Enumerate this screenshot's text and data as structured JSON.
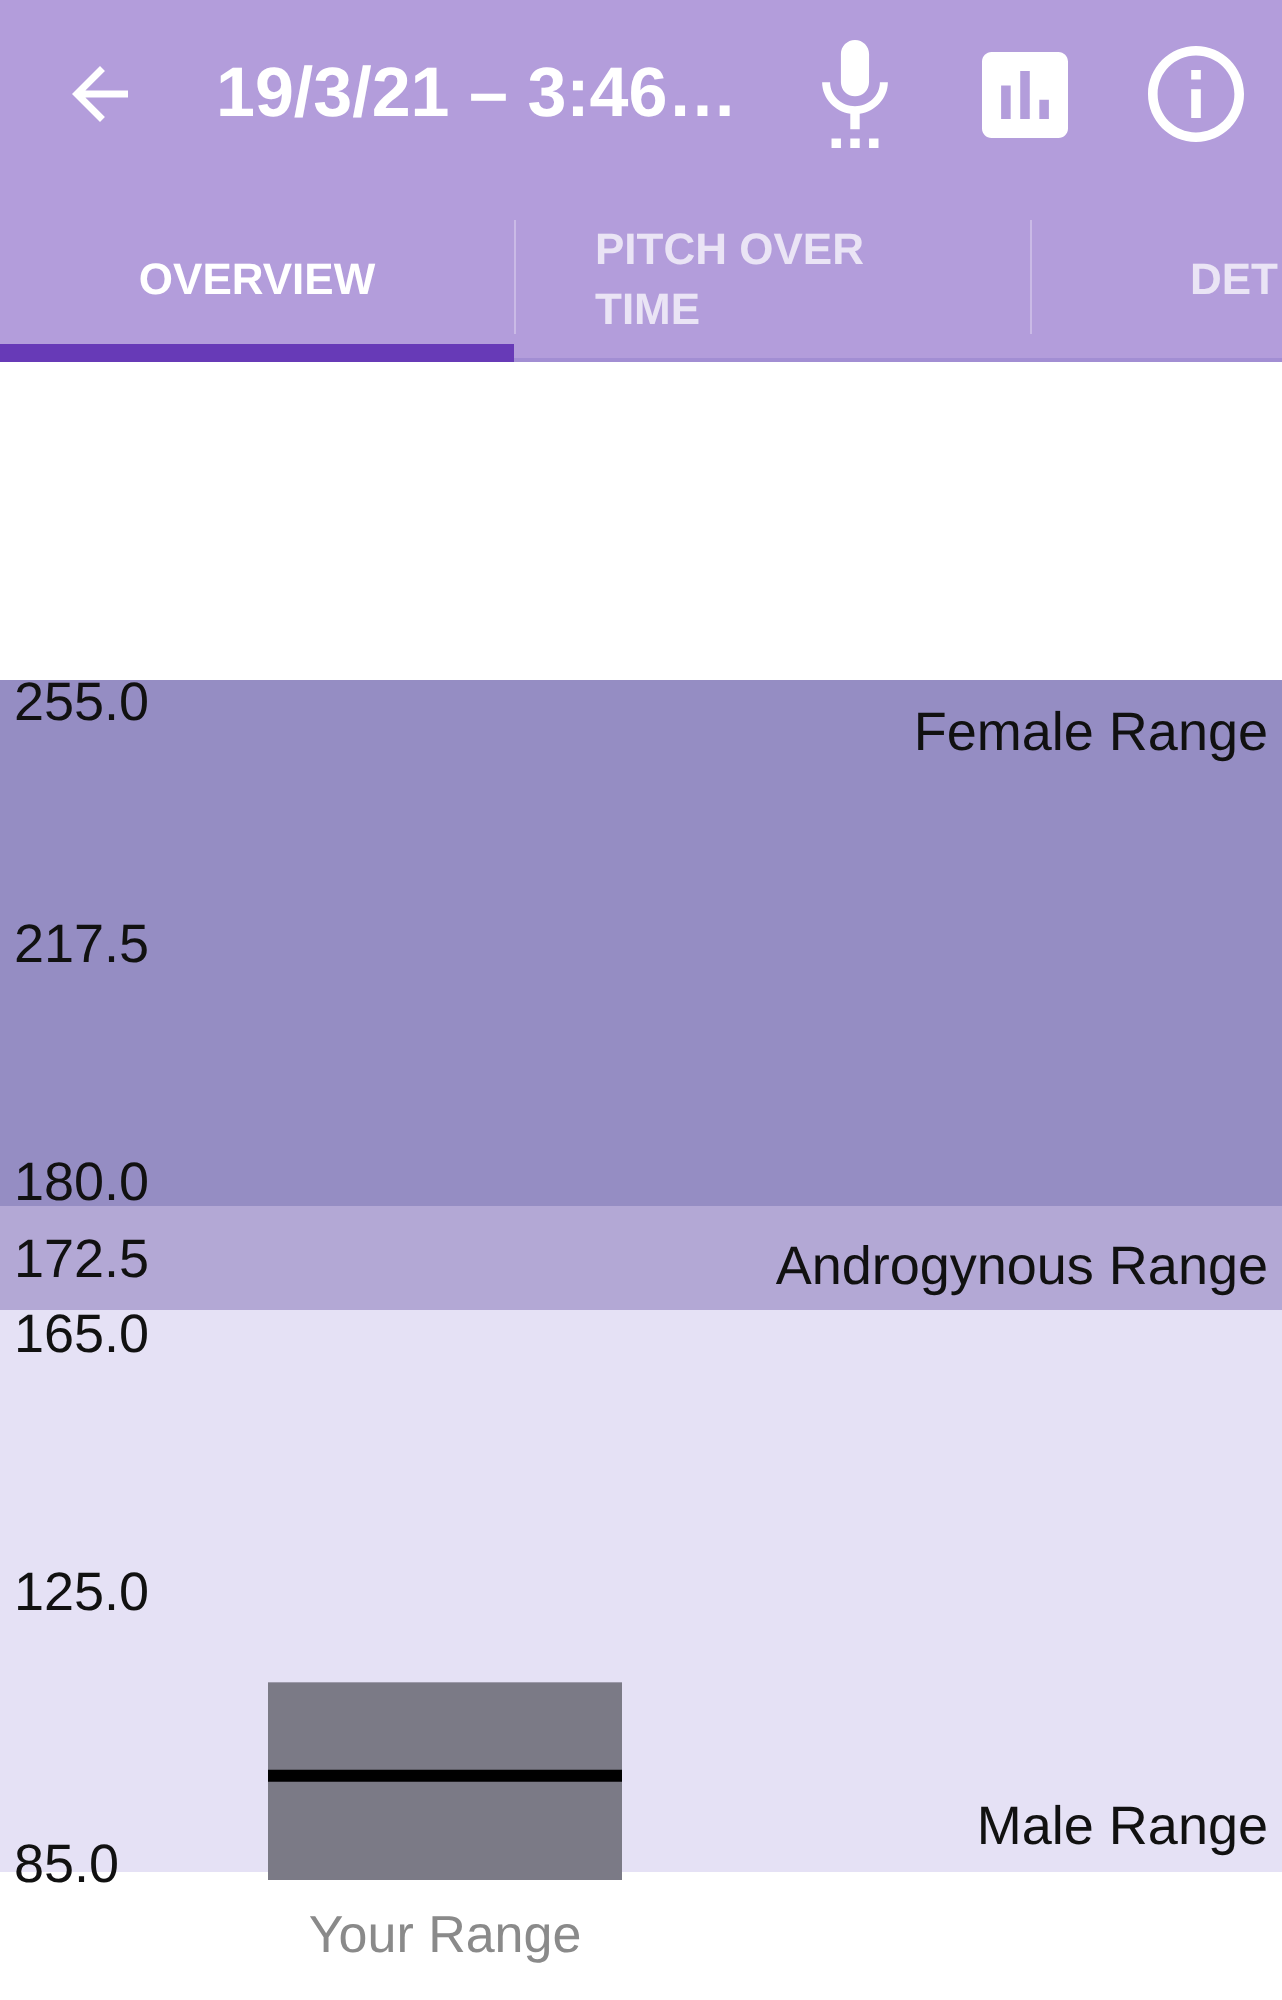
{
  "app_bar": {
    "title": "19/3/21 – 3:46…"
  },
  "tabs": [
    {
      "label": "OVERVIEW",
      "selected": true
    },
    {
      "label": "PITCH OVER TIME",
      "selected": false
    },
    {
      "label": "DET",
      "selected": false
    }
  ],
  "overview": {
    "chart_data": {
      "type": "bar",
      "categories": [
        "Your Range"
      ],
      "values": [
        112
      ],
      "ylim": [
        85,
        255
      ],
      "yticks": [
        {
          "value": 255,
          "label": "255.0"
        },
        {
          "value": 217.5,
          "label": "217.5"
        },
        {
          "value": 180,
          "label": "180.0"
        },
        {
          "value": 172.5,
          "label": "172.5"
        },
        {
          "value": 165,
          "label": "165.0"
        },
        {
          "value": 125,
          "label": "125.0"
        },
        {
          "value": 85,
          "label": "85.0"
        }
      ],
      "bands": [
        {
          "axis": "y",
          "from": 180,
          "to": 255,
          "label": "Female Range",
          "color": "#958dc3"
        },
        {
          "axis": "y",
          "from": 165,
          "to": 180,
          "label": "Androgynous Range",
          "color": "#b3a8d5"
        },
        {
          "axis": "y",
          "from": 85,
          "to": 165,
          "label": "Male Range",
          "color": "#e5e1f5"
        }
      ],
      "ref_lines": [
        {
          "axis": "y",
          "value": 98.7
        }
      ]
    }
  }
}
